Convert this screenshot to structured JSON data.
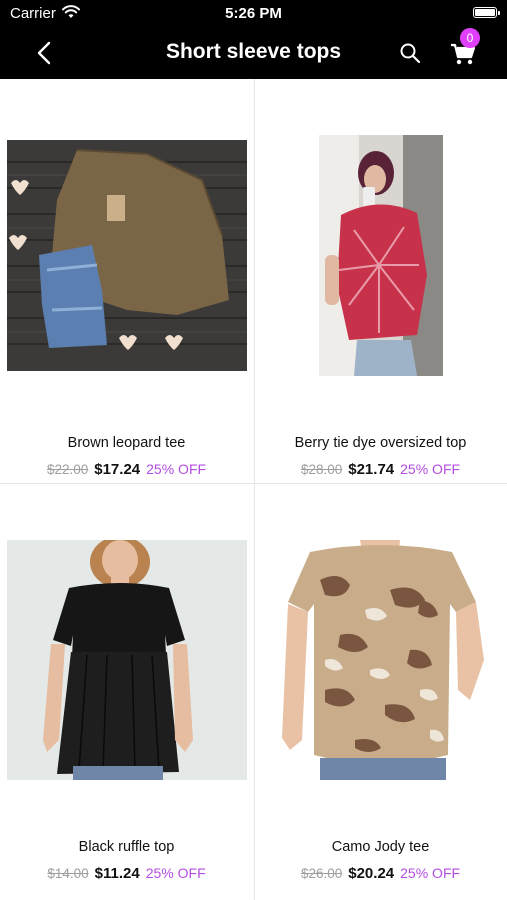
{
  "status_bar": {
    "carrier": "Carrier",
    "time": "5:26 PM"
  },
  "nav": {
    "title": "Short sleeve tops",
    "cart_count": "0",
    "back_icon": "chevron-left-icon",
    "search_icon": "search-icon",
    "cart_icon": "cart-icon"
  },
  "colors": {
    "accent": "#e040fb",
    "discount": "#b34de0",
    "header": "#000000"
  },
  "products": [
    {
      "name": "Brown leopard tee",
      "original_price": "$22.00",
      "price": "$17.24",
      "discount": "25% OFF"
    },
    {
      "name": "Berry tie dye oversized top",
      "original_price": "$28.00",
      "price": "$21.74",
      "discount": "25% OFF"
    },
    {
      "name": "Black ruffle top",
      "original_price": "$14.00",
      "price": "$11.24",
      "discount": "25% OFF"
    },
    {
      "name": "Camo Jody tee",
      "original_price": "$26.00",
      "price": "$20.24",
      "discount": "25% OFF"
    }
  ]
}
